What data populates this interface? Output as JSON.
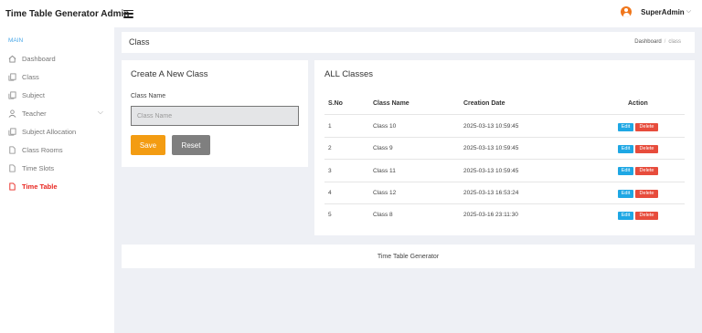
{
  "app": {
    "title": "Time Table Generator Admin"
  },
  "user": {
    "name": "SuperAdmin"
  },
  "sidebar": {
    "section": "MAIN",
    "items": [
      {
        "label": "Dashboard",
        "icon": "home-icon"
      },
      {
        "label": "Class",
        "icon": "copy-icon"
      },
      {
        "label": "Subject",
        "icon": "copy-icon"
      },
      {
        "label": "Teacher",
        "icon": "user-icon"
      },
      {
        "label": "Subject Allocation",
        "icon": "copy-icon"
      },
      {
        "label": "Class Rooms",
        "icon": "file-icon"
      },
      {
        "label": "Time Slots",
        "icon": "file-icon"
      },
      {
        "label": "Time Table",
        "icon": "file-icon",
        "active": true
      }
    ]
  },
  "page": {
    "title": "Class",
    "breadcrumb": [
      "Dashboard",
      "class"
    ]
  },
  "form": {
    "title": "Create A New Class",
    "class_name_label": "Class Name",
    "class_name_placeholder": "Class Name",
    "class_name_value": "",
    "save_label": "Save",
    "reset_label": "Reset"
  },
  "table": {
    "title": "ALL Classes",
    "columns": [
      "S.No",
      "Class Name",
      "Creation Date",
      "Action"
    ],
    "rows": [
      {
        "sno": "1",
        "name": "Class 10",
        "date": "2025-03-13 10:59:45"
      },
      {
        "sno": "2",
        "name": "Class 9",
        "date": "2025-03-13 10:59:45"
      },
      {
        "sno": "3",
        "name": "Class 11",
        "date": "2025-03-13 10:59:45"
      },
      {
        "sno": "4",
        "name": "Class 12",
        "date": "2025-03-13 16:53:24"
      },
      {
        "sno": "5",
        "name": "Class 8",
        "date": "2025-03-16 23:11:30"
      }
    ],
    "edit_label": "Edit",
    "delete_label": "Delete"
  },
  "footer": {
    "text": "Time Table Generator"
  },
  "colors": {
    "accent_orange": "#f39c12",
    "reset_gray": "#7f7f7f",
    "edit_blue": "#1ea7e4",
    "delete_red": "#e74c3c",
    "active_red": "#e8251f",
    "section_blue": "#4aa8e8",
    "avatar_orange": "#f0761b"
  }
}
